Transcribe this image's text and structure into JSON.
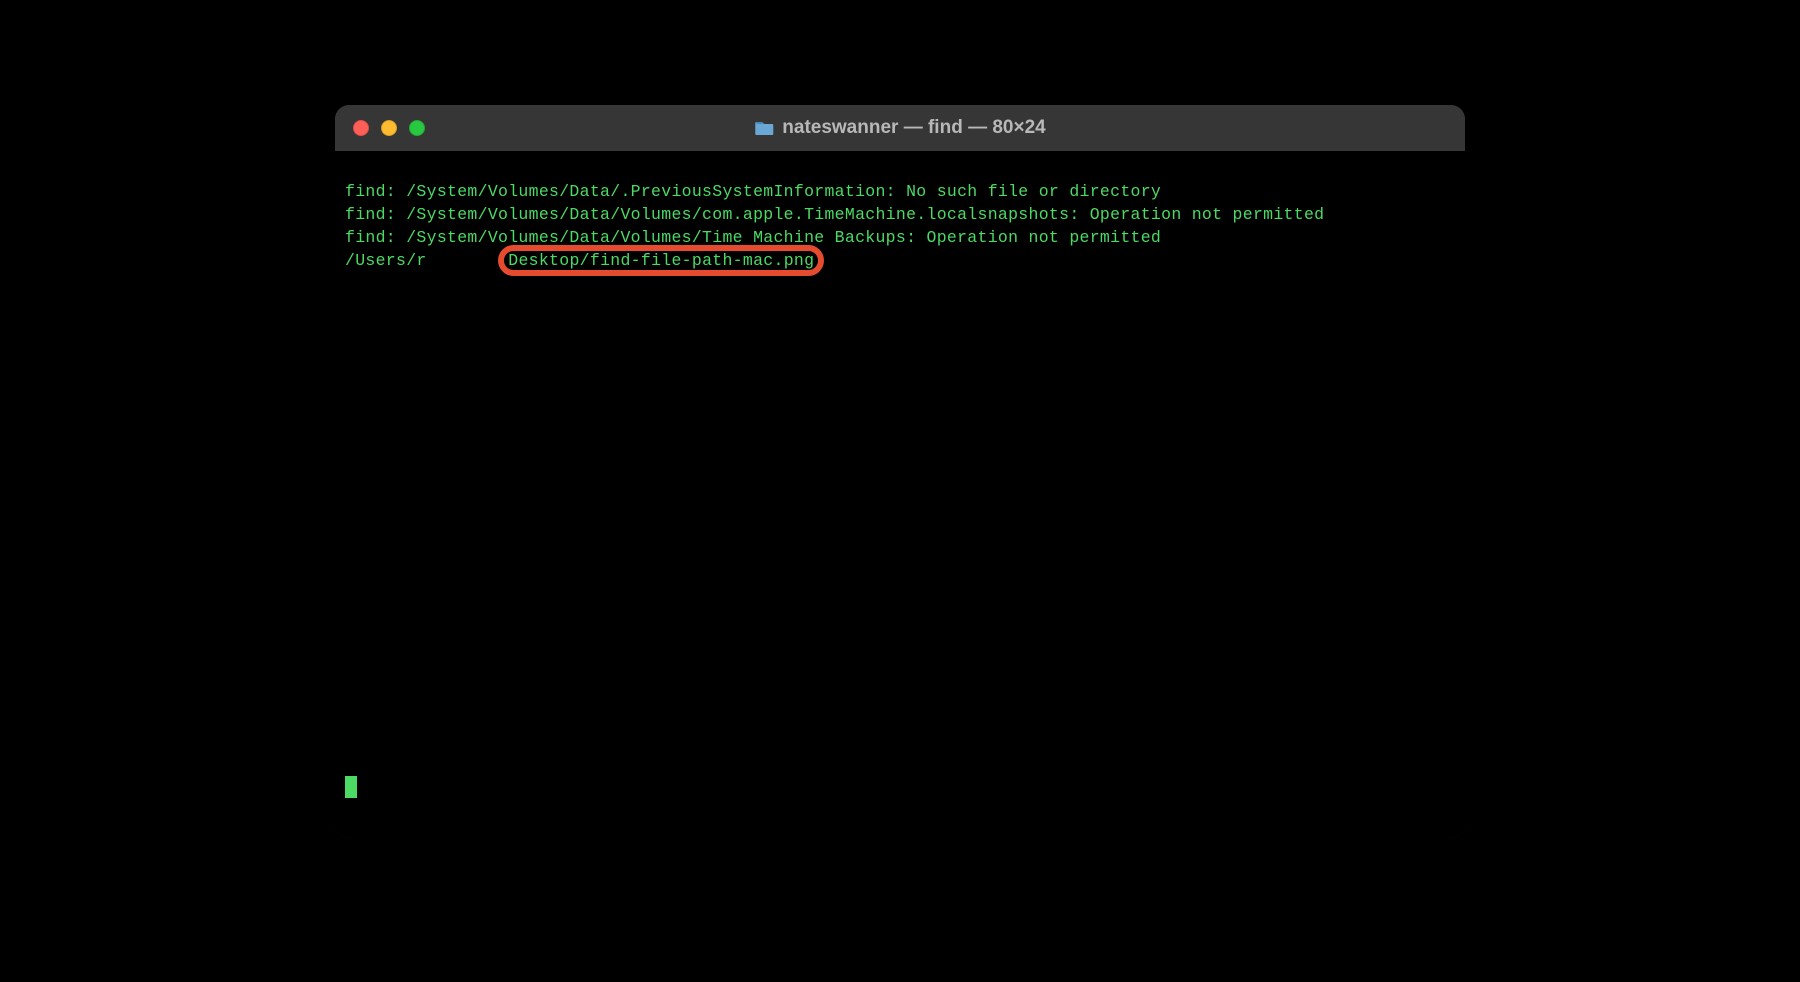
{
  "window": {
    "title": "nateswanner — find — 80×24"
  },
  "traffic_lights": {
    "close": "close",
    "minimize": "minimize",
    "maximize": "maximize"
  },
  "terminal": {
    "line1": "find: /System/Volumes/Data/.PreviousSystemInformation: No such file or directory",
    "line2": "find: /System/Volumes/Data/Volumes/com.apple.TimeMachine.localsnapshots: Operation not permitted",
    "line3": "find: /System/Volumes/Data/Volumes/Time Machine Backups: Operation not permitted",
    "line4_prefix": "/Users/r",
    "line4_gap": "        ",
    "line4_highlighted": "Desktop/find-file-path-mac.png"
  },
  "colors": {
    "text": "#4cd964",
    "bg": "#000000",
    "titlebar": "#363636",
    "highlight_border": "#e44b2f"
  }
}
